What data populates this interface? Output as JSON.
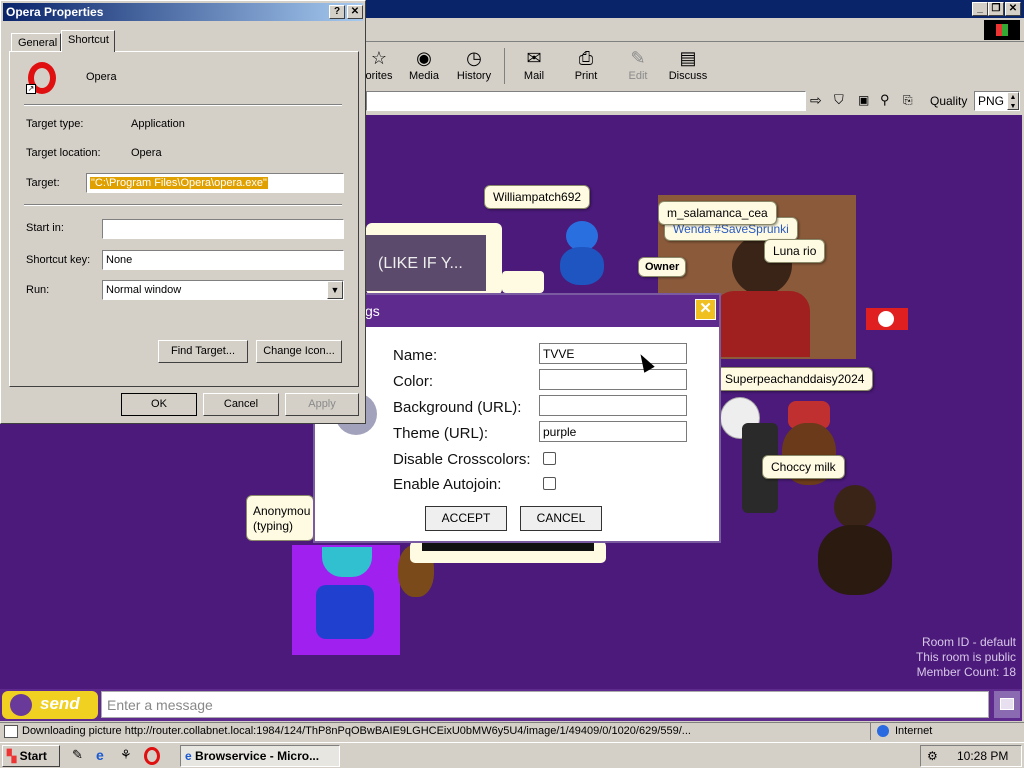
{
  "browser": {
    "toolbar": [
      {
        "label": "orites",
        "icon": "favorites-icon"
      },
      {
        "label": "Media",
        "icon": "media-icon"
      },
      {
        "label": "History",
        "icon": "history-icon"
      },
      {
        "label": "Mail",
        "icon": "mail-icon"
      },
      {
        "label": "Print",
        "icon": "print-icon"
      },
      {
        "label": "Edit",
        "icon": "edit-icon"
      },
      {
        "label": "Discuss",
        "icon": "discuss-icon"
      }
    ],
    "quality_label": "Quality",
    "quality_value": "PNG"
  },
  "chat": {
    "bubbles": {
      "williampatch": "Williampatch692",
      "salamanca": "m_salamanca_cea",
      "wenda": "Wenda #SaveSprunki",
      "luna": "Luna rio",
      "owner": "Owner",
      "superpeach": "Superpeachanddaisy2024",
      "choccy": "Choccy milk",
      "anonymous_1": "Anonymou",
      "anonymous_2": "(typing)",
      "like_text": "(LIKE IF Y..."
    },
    "room_info": {
      "id": "Room ID - default",
      "public": "This room is public",
      "count": "Member Count: 18"
    },
    "send_label": "send",
    "message_placeholder": "Enter a message"
  },
  "settings": {
    "title_fragment": "gs",
    "fields": {
      "name_label": "Name:",
      "name_value": "TVVE",
      "color_label": "Color:",
      "color_value": "",
      "background_label": "Background (URL):",
      "background_value": "",
      "theme_label": "Theme (URL):",
      "theme_value": "purple",
      "crosscolors_label": "Disable Crosscolors:",
      "autojoin_label": "Enable Autojoin:"
    },
    "accept": "ACCEPT",
    "cancel": "CANCEL"
  },
  "props": {
    "title": "Opera Properties",
    "tabs": [
      "General",
      "Shortcut"
    ],
    "app_name": "Opera",
    "target_type_label": "Target type:",
    "target_type_value": "Application",
    "target_location_label": "Target location:",
    "target_location_value": "Opera",
    "target_label": "Target:",
    "target_value": "\"C:\\Program Files\\Opera\\opera.exe\"",
    "start_in_label": "Start in:",
    "start_in_value": "",
    "shortcut_key_label": "Shortcut key:",
    "shortcut_key_value": "None",
    "run_label": "Run:",
    "run_value": "Normal window",
    "find_target": "Find Target...",
    "change_icon": "Change Icon...",
    "ok": "OK",
    "cancel": "Cancel",
    "apply": "Apply"
  },
  "status": {
    "text": "Downloading picture http://router.collabnet.local:1984/124/ThP8nPqOBwBAIE9LGHCEixU0bMW6y5U4/image/1/49409/0/1020/629/559/...",
    "zone": "Internet"
  },
  "taskbar": {
    "start": "Start",
    "task": "Browservice - Micro...",
    "clock": "10:28 PM"
  },
  "colors": {
    "chat_bg": "#4b1a7a",
    "dialog_header": "#5e2a8e",
    "titlebar": "#0a246a",
    "selection": "#e0a000"
  }
}
